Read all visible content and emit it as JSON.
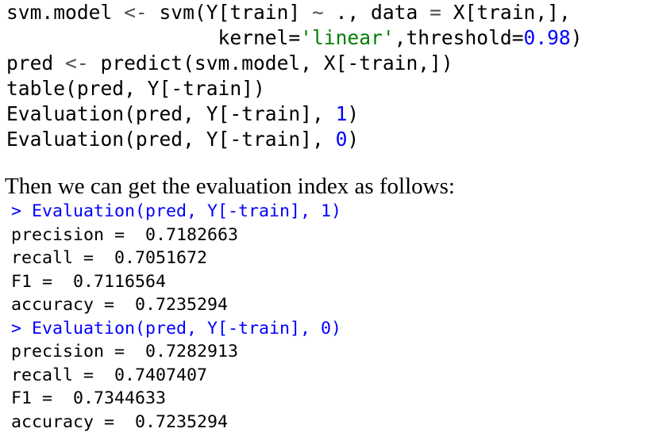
{
  "code_lines": [
    [
      "svm.model ",
      "<- ",
      "svm(Y[train] ",
      "~",
      " ., data ",
      "= ",
      "X[train,],"
    ],
    [
      "                  kernel=",
      "'linear'",
      ",threshold=",
      "0.98",
      ")"
    ],
    [
      "pred ",
      "<- ",
      "predict(svm.model, X[-train,])"
    ],
    [
      "table(pred, Y[-train])"
    ],
    [
      "Evaluation(pred, Y[-train], ",
      "1",
      ")"
    ],
    [
      "Evaluation(pred, Y[-train], ",
      "0",
      ")"
    ]
  ],
  "prose": "Then we can get the evaluation index as follows:",
  "console": {
    "blocks": [
      {
        "command": "> Evaluation(pred, Y[-train], 1)",
        "metrics": [
          {
            "label": "precision = ",
            "value": "0.7182663"
          },
          {
            "label": "recall = ",
            "value": "0.7051672"
          },
          {
            "label": "F1 = ",
            "value": "0.7116564"
          },
          {
            "label": "accuracy = ",
            "value": "0.7235294"
          }
        ]
      },
      {
        "command": "> Evaluation(pred, Y[-train], 0)",
        "metrics": [
          {
            "label": "precision = ",
            "value": "0.7282913"
          },
          {
            "label": "recall = ",
            "value": "0.7407407"
          },
          {
            "label": "F1 = ",
            "value": "0.7344633"
          },
          {
            "label": "accuracy = ",
            "value": "0.7235294"
          }
        ]
      }
    ]
  }
}
